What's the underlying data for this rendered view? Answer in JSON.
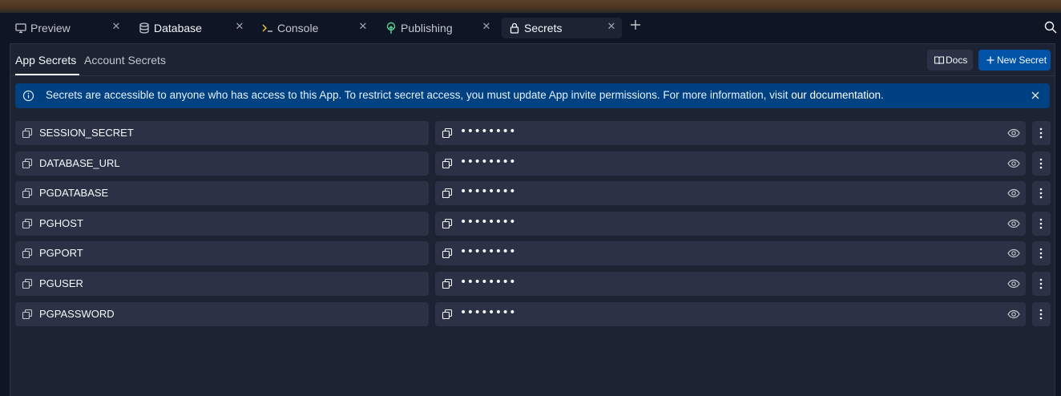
{
  "tabs": [
    {
      "label": "Preview",
      "icon": "monitor-icon",
      "active": false
    },
    {
      "label": "Database",
      "icon": "database-icon",
      "active": false
    },
    {
      "label": "Console",
      "icon": "terminal-icon",
      "active": false
    },
    {
      "label": "Publishing",
      "icon": "publish-icon",
      "active": false
    },
    {
      "label": "Secrets",
      "icon": "lock-icon",
      "active": true
    }
  ],
  "subtabs": [
    {
      "label": "App Secrets",
      "active": true
    },
    {
      "label": "Account Secrets",
      "active": false
    }
  ],
  "toolbar": {
    "docs_label": "Docs",
    "new_secret_label": "New Secret"
  },
  "banner": {
    "text": "Secrets are accessible to anyone who has access to this App. To restrict secret access, you must update App invite permissions. For more information, visit ",
    "link_text": "our documentation",
    "suffix": "."
  },
  "secrets": [
    {
      "key": "SESSION_SECRET",
      "masked_value": "••••••••"
    },
    {
      "key": "DATABASE_URL",
      "masked_value": "••••••••"
    },
    {
      "key": "PGDATABASE",
      "masked_value": "••••••••"
    },
    {
      "key": "PGHOST",
      "masked_value": "••••••••"
    },
    {
      "key": "PGPORT",
      "masked_value": "••••••••"
    },
    {
      "key": "PGUSER",
      "masked_value": "••••••••"
    },
    {
      "key": "PGPASSWORD",
      "masked_value": "••••••••"
    }
  ],
  "colors": {
    "background": "#0e1525",
    "surface": "#1c2333",
    "cell": "#2b3245",
    "accent_blue": "#0053a6",
    "banner_blue": "#004182",
    "publishing_icon": "#5ad08f"
  }
}
